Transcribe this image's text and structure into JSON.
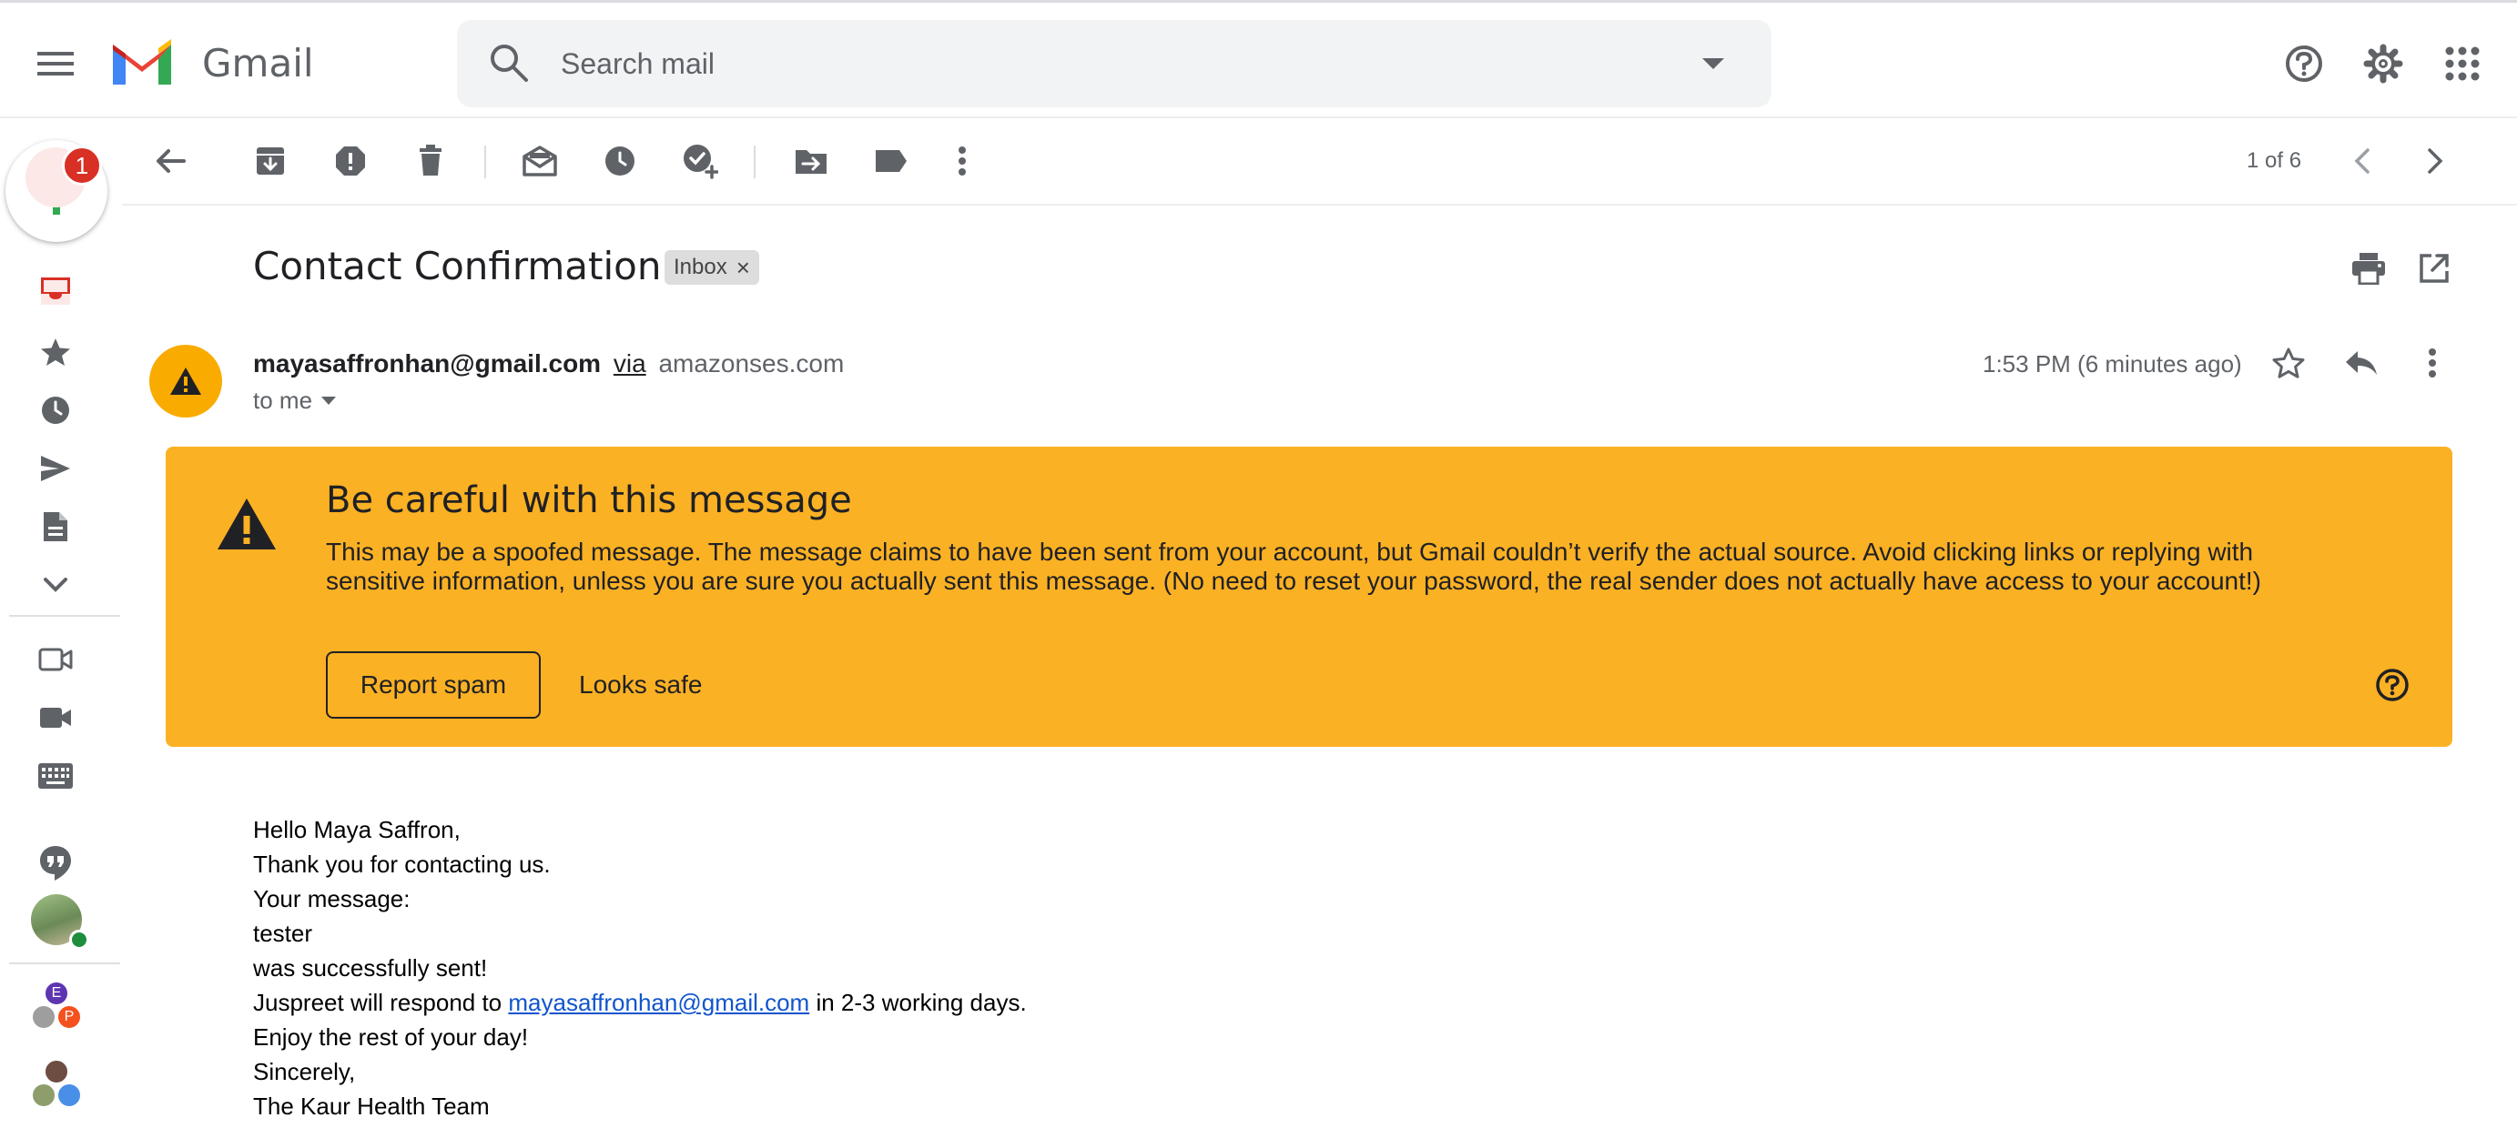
{
  "app": {
    "name": "Gmail"
  },
  "search": {
    "placeholder": "Search mail"
  },
  "header_icons": [
    "support-icon",
    "settings-icon",
    "apps-icon"
  ],
  "rail": {
    "inbox_badge": "1",
    "items": [
      "inbox-icon",
      "starred-icon",
      "snoozed-icon",
      "sent-icon",
      "drafts-icon",
      "more-icon",
      "new-meeting-icon",
      "join-meeting-icon",
      "keyboard-icon",
      "hangouts-icon"
    ],
    "contacts": [
      {
        "initial": "E",
        "color": "#5e35b1"
      },
      {
        "initial": "P",
        "color": "#f4511e"
      }
    ]
  },
  "toolbar": {
    "pager": "1 of 6",
    "icons": [
      "back-icon",
      "archive-icon",
      "report-spam-icon",
      "delete-icon",
      "mark-unread-icon",
      "snooze-icon",
      "add-to-tasks-icon",
      "move-to-icon",
      "labels-icon",
      "more-vert-icon"
    ]
  },
  "message": {
    "subject": "Contact Confirmation",
    "label": "Inbox",
    "sender_email": "mayasaffronhan@gmail.com",
    "via_text": "via",
    "via_domain": "amazonses.com",
    "to": "to me",
    "time": "1:53 PM (6 minutes ago)"
  },
  "warning": {
    "title": "Be careful with this message",
    "body": "This may be a spoofed message. The message claims to have been sent from your account, but Gmail couldn’t verify the actual source. Avoid clicking links or replying with sensitive information, unless you are sure you actually sent this message. (No need to reset your password, the real sender does not actually have access to your account!)",
    "report_spam": "Report spam",
    "looks_safe": "Looks safe",
    "color": "#fbb124"
  },
  "body": {
    "line1": "Hello Maya Saffron,",
    "line2": "Thank you for contacting us.",
    "line3": "Your message:",
    "line4": "tester",
    "line5": "was successfully sent!",
    "line6_prefix": "Juspreet will respond to",
    "line6_link": "mayasaffronhan@gmail.com",
    "line6_suffix": "in 2-3 working days.",
    "line7": "Enjoy the rest of your day!",
    "line8": "Sincerely,",
    "line9": "The Kaur Health Team"
  },
  "colors": {
    "accent_red": "#d93025",
    "link": "#1155cc",
    "icon_gray": "#5f6368"
  }
}
